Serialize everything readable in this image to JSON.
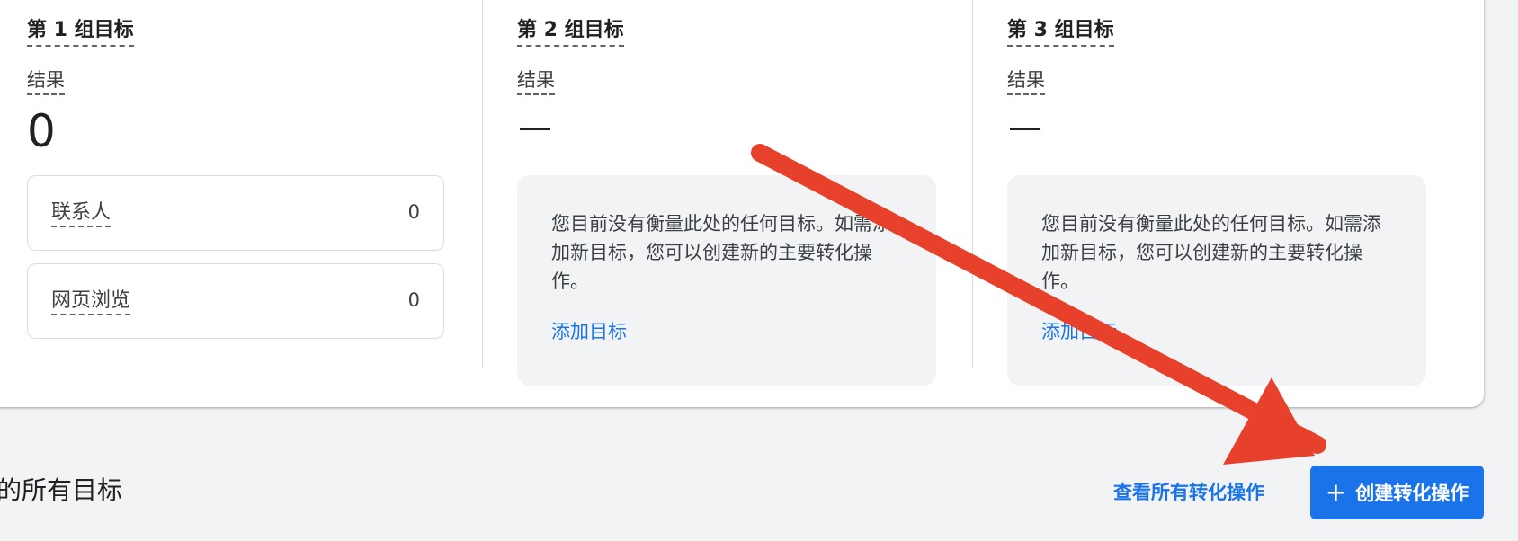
{
  "groups": [
    {
      "title": "第 1 组目标",
      "results_label": "结果",
      "value": "0",
      "metrics": [
        {
          "label": "联系人",
          "value": "0"
        },
        {
          "label": "网页浏览",
          "value": "0"
        }
      ]
    },
    {
      "title": "第 2 组目标",
      "results_label": "结果",
      "value": "—",
      "empty_text": "您目前没有衡量此处的任何目标。如需添加新目标，您可以创建新的主要转化操作。",
      "add_goal": "添加目标"
    },
    {
      "title": "第 3 组目标",
      "results_label": "结果",
      "value": "—",
      "empty_text": "您目前没有衡量此处的任何目标。如需添加新目标，您可以创建新的主要转化操作。",
      "add_goal": "添加目标"
    }
  ],
  "footer": {
    "section_title": "的所有目标",
    "view_all_label": "查看所有转化操作",
    "create_label": "创建转化操作",
    "create_icon": "plus-icon"
  },
  "colors": {
    "link": "#1a73e8",
    "button_bg": "#1a73e8",
    "page_bg": "#f1f3f4",
    "annotation_arrow": "#e8412b"
  }
}
